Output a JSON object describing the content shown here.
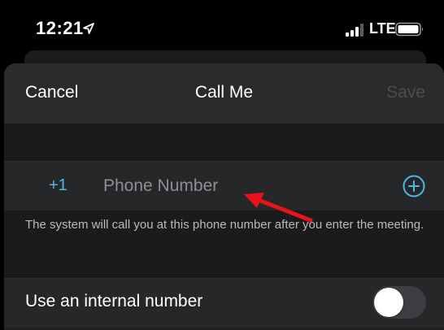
{
  "status_bar": {
    "time": "12:21",
    "network": "LTE",
    "icons": [
      "location-arrow-icon",
      "signal-bars-icon",
      "battery-icon"
    ]
  },
  "nav": {
    "cancel_label": "Cancel",
    "title": "Call Me",
    "save_label": "Save"
  },
  "phone_entry": {
    "country_code": "+1",
    "placeholder": "Phone Number",
    "value": "",
    "add_icon": "plus-circle-icon"
  },
  "hint": {
    "text": "The system will call you at this phone number after you enter the meeting."
  },
  "internal_number": {
    "label": "Use an internal number",
    "enabled": false
  },
  "annotation": {
    "icon": "red-arrow-annotation",
    "points_to": "phone-number-input"
  },
  "colors": {
    "accent": "#4fb8e6",
    "background": "#1f2022",
    "row": "#262729",
    "save_disabled": "#4c4d50",
    "annotation": "#e8131a"
  }
}
